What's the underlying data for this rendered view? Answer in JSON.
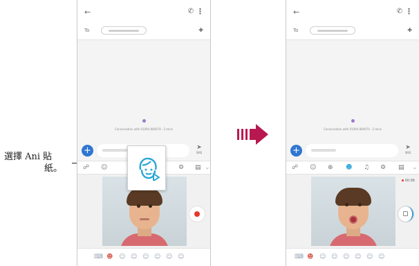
{
  "callout": {
    "text_line1": "選擇 Ani 貼",
    "text_line2": "紙。"
  },
  "phone": {
    "back_icon": "←",
    "call_icon": "✆",
    "more_icon": "⋮",
    "to_label": "To",
    "add_people_icon": "✚",
    "conversation_text": "Conversation with 01094 800070 · 2 mins",
    "plus_icon": "+",
    "send_icon": "➤",
    "send_label": "SMS",
    "recording_time": "00:06"
  },
  "toolbar_icons": [
    "shortcut-icon",
    "emoji-icon",
    "gif-icon",
    "ani-sticker-icon",
    "mic-icon",
    "settings-icon",
    "clipboard-icon",
    "collapse-icon"
  ],
  "sticker_icons": [
    "keyboard-icon",
    "person-sticker-icon",
    "cat-sticker-icon",
    "bear-sticker-icon",
    "dog-sticker-icon",
    "bird-sticker-icon",
    "rabbit-sticker-icon",
    "ghost-sticker-icon"
  ],
  "colors": {
    "accent": "#2f77d1",
    "record": "#e8362c",
    "arrow": "#b81850",
    "ani_active": "#2aa6d6"
  }
}
